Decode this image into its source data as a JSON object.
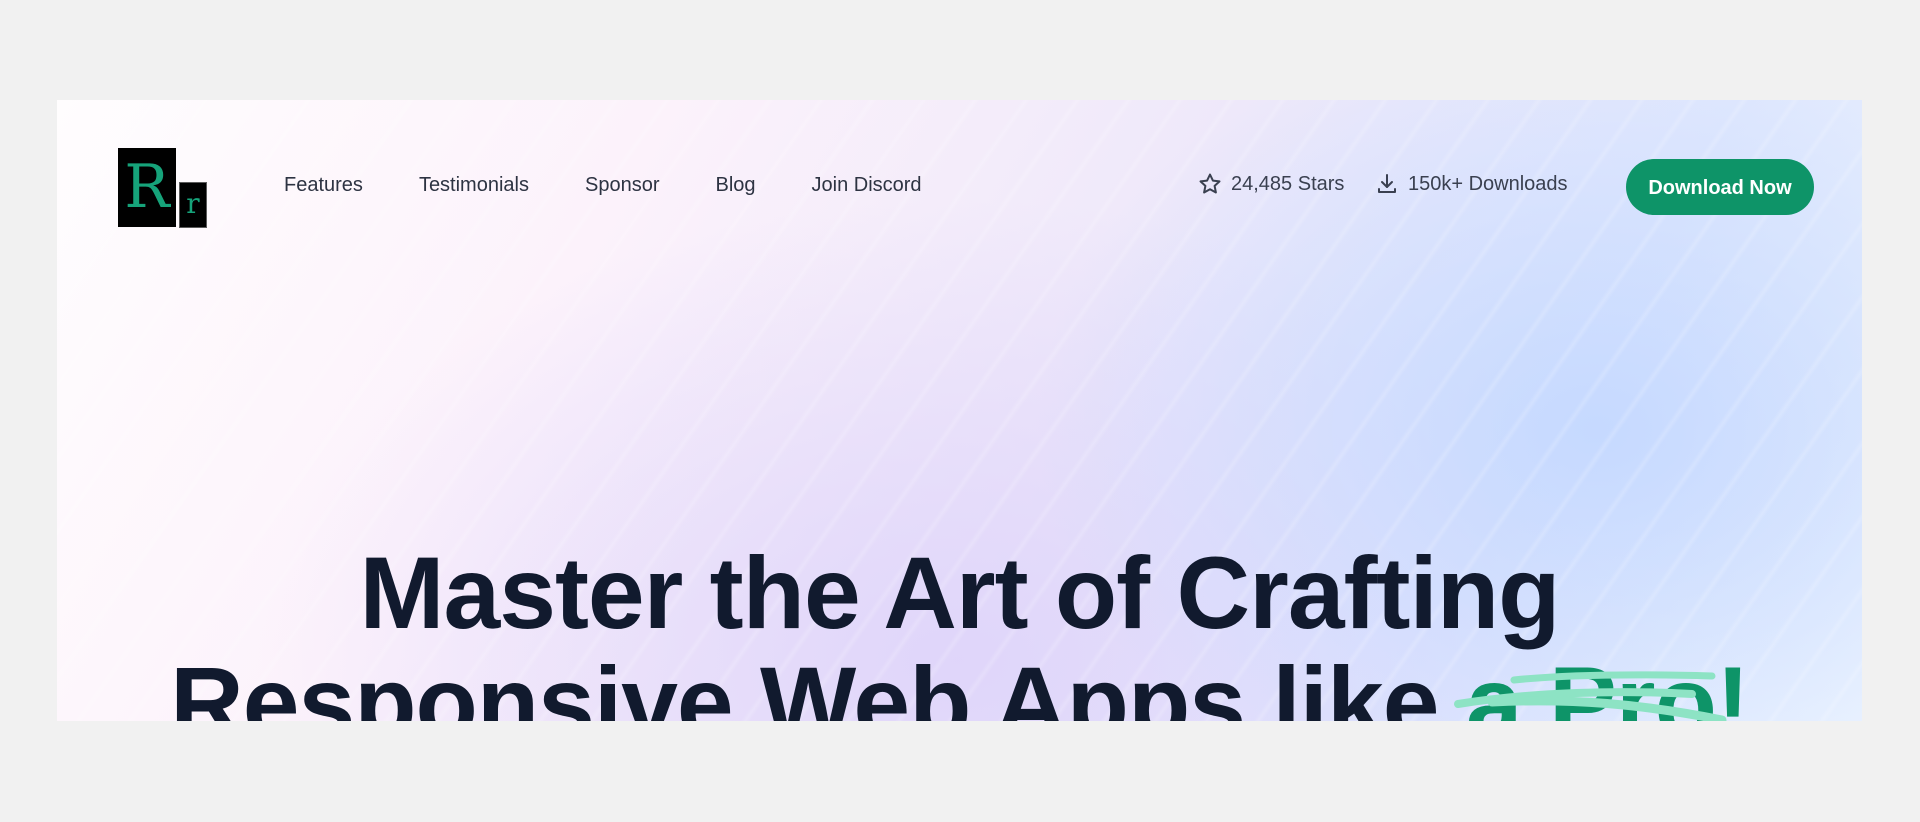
{
  "logo": {
    "letter_big": "R",
    "letter_small": "r"
  },
  "nav": {
    "items": [
      {
        "label": "Features"
      },
      {
        "label": "Testimonials"
      },
      {
        "label": "Sponsor"
      },
      {
        "label": "Blog"
      },
      {
        "label": "Join Discord"
      }
    ]
  },
  "stats": {
    "stars": {
      "label": "24,485 Stars",
      "icon": "star-icon"
    },
    "downloads": {
      "label": "150k+ Downloads",
      "icon": "download-icon"
    }
  },
  "cta": {
    "label": "Download Now"
  },
  "hero": {
    "line1": "Master the Art of Crafting",
    "line2_prefix": "Responsive Web Apps like ",
    "line2_accent": "a Pro!"
  },
  "colors": {
    "accent": "#0e9468",
    "heading": "#111a2e",
    "scribble": "#8de3c4",
    "background": "#f1f1f1"
  }
}
